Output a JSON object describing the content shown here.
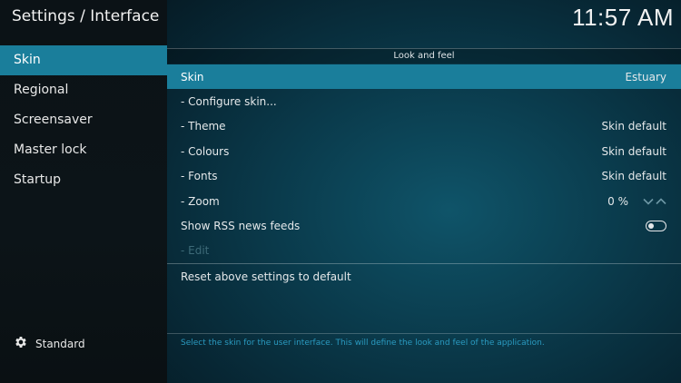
{
  "header": {
    "title": "Settings / Interface",
    "clock": "11:57 AM"
  },
  "sidebar": {
    "items": [
      {
        "label": "Skin",
        "active": true
      },
      {
        "label": "Regional"
      },
      {
        "label": "Screensaver"
      },
      {
        "label": "Master lock"
      },
      {
        "label": "Startup"
      }
    ],
    "level": {
      "label": "Standard",
      "icon": "gear-icon"
    }
  },
  "section": {
    "title": "Look and feel"
  },
  "settings": {
    "skin": {
      "label": "Skin",
      "value": "Estuary"
    },
    "configure": {
      "label": "- Configure skin..."
    },
    "theme": {
      "label": "- Theme",
      "value": "Skin default"
    },
    "colours": {
      "label": "- Colours",
      "value": "Skin default"
    },
    "fonts": {
      "label": "- Fonts",
      "value": "Skin default"
    },
    "zoom": {
      "label": "- Zoom",
      "value": "0 %"
    },
    "rss": {
      "label": "Show RSS news feeds",
      "enabled": false
    },
    "edit": {
      "label": "- Edit"
    }
  },
  "reset": {
    "label": "Reset above settings to default"
  },
  "help": {
    "text": "Select the skin for the user interface. This will define the look and feel of the application."
  },
  "colors": {
    "accent": "#1a7e9b",
    "help_text": "#2a9ac0"
  }
}
